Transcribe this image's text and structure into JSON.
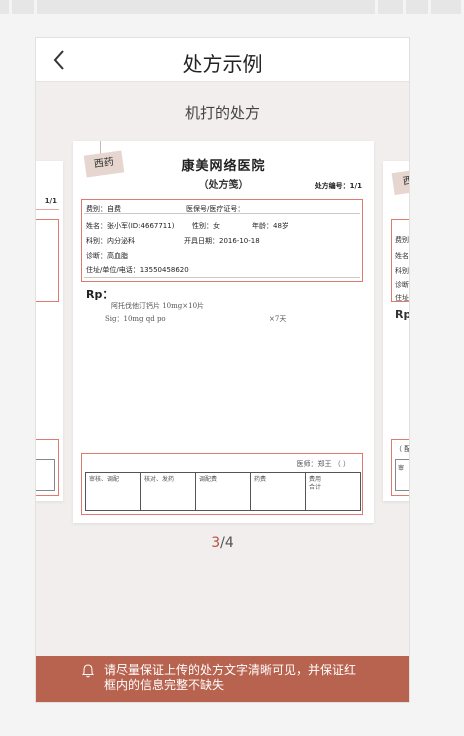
{
  "nav": {
    "title": "处方示例"
  },
  "subtitle": "机打的处方",
  "prescription": {
    "tag": "西药",
    "hospital": "康美网络医院",
    "type": "（处方笺）",
    "number": "处方编号：1/1",
    "category": "费别：自费",
    "insurance": "医保号/医疗证号：",
    "name": "姓名：张小军(ID:4667711)",
    "gender": "性别：女",
    "age": "年龄：48岁",
    "dept": "科别：内分泌科",
    "date": "开具日期：2016-10-18",
    "diagnosis": "诊断：高血脂",
    "address": "住址/单位/电话：13550458620",
    "rp": "Rp：",
    "drug_name": "阿托伐他汀钙片   10mg×10片",
    "drug_usage": "Sig：10mg  qd  po",
    "drug_qty": "×7天",
    "signature": "医师：郑王      （      ）",
    "sign_cells": [
      "审核、调配",
      "核对、发药",
      "调配费",
      "药费",
      "费用\n合计"
    ]
  },
  "peek_prev": {
    "number": "1/1"
  },
  "peek_next": {
    "tag": "西",
    "rp": "Rp",
    "labels": [
      "费别",
      "姓名",
      "科别",
      "诊断",
      "住址"
    ],
    "sig": "（ 配",
    "sig2": "审"
  },
  "pager": {
    "current": "3",
    "total": "/4"
  },
  "notice": "请尽量保证上传的处方文字清晰可见，并保证红框内的信息完整不缺失",
  "colors": {
    "accent": "#b8634f",
    "frame": "#e07a6f"
  }
}
